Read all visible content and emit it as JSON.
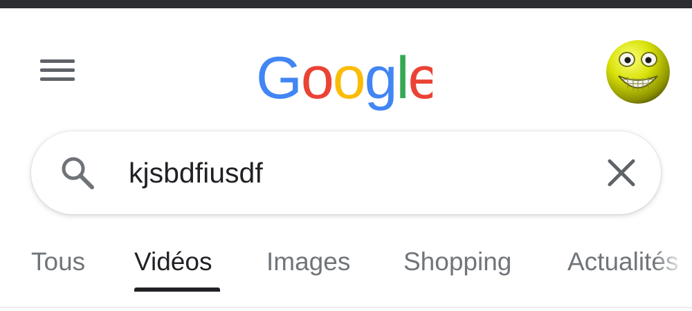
{
  "header": {
    "logo_text": "Google",
    "menu_icon": "hamburger-menu-icon",
    "avatar_icon": "smiley-face-avatar"
  },
  "search": {
    "query": "kjsbdfiusdf",
    "search_icon": "search-icon",
    "clear_icon": "close-icon"
  },
  "tabs": [
    {
      "label": "Tous",
      "active": false
    },
    {
      "label": "Vidéos",
      "active": true
    },
    {
      "label": "Images",
      "active": false
    },
    {
      "label": "Shopping",
      "active": false
    },
    {
      "label": "Actualités",
      "active": false
    }
  ],
  "colors": {
    "google_blue": "#4285F4",
    "google_red": "#EA4335",
    "google_yellow": "#FBBC05",
    "google_green": "#34A853",
    "text_primary": "#202124",
    "text_secondary": "#70757a",
    "icon_gray": "#5f6368"
  }
}
